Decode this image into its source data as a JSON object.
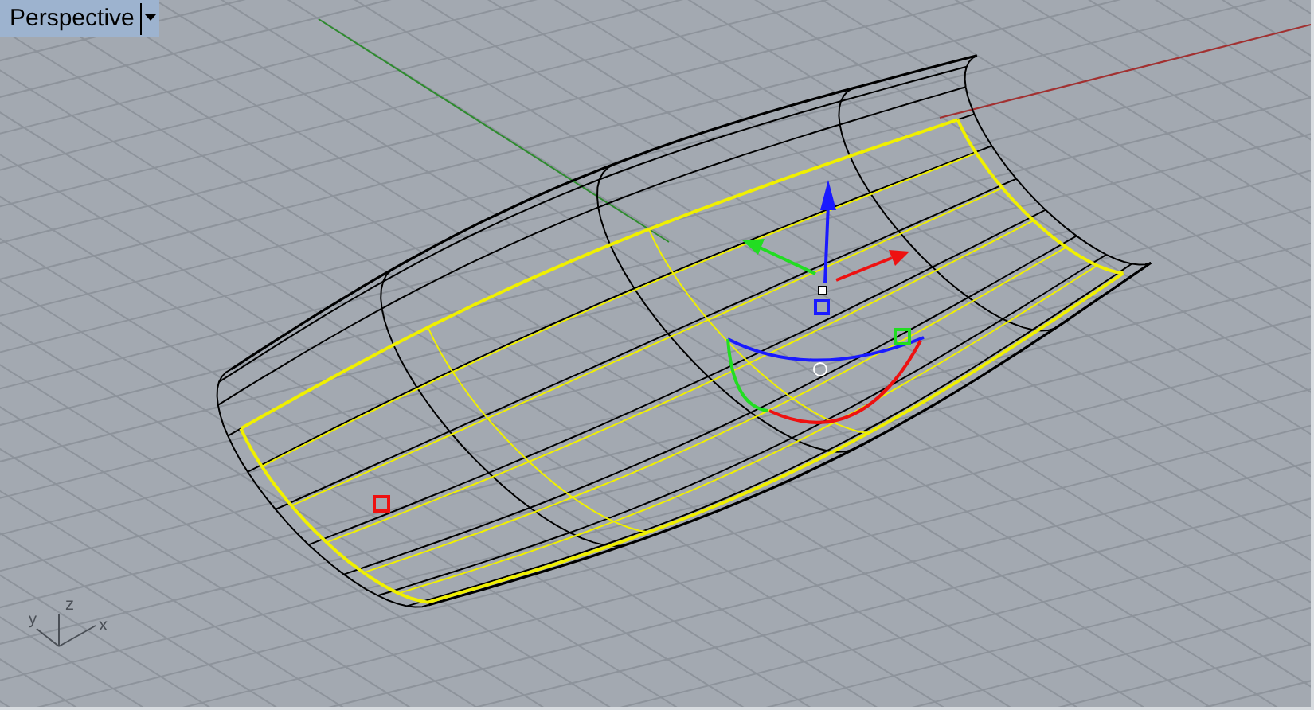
{
  "viewport": {
    "title": "Perspective"
  },
  "axis_icon": {
    "z_label": "z",
    "y_label": "y",
    "x_label": "x"
  }
}
